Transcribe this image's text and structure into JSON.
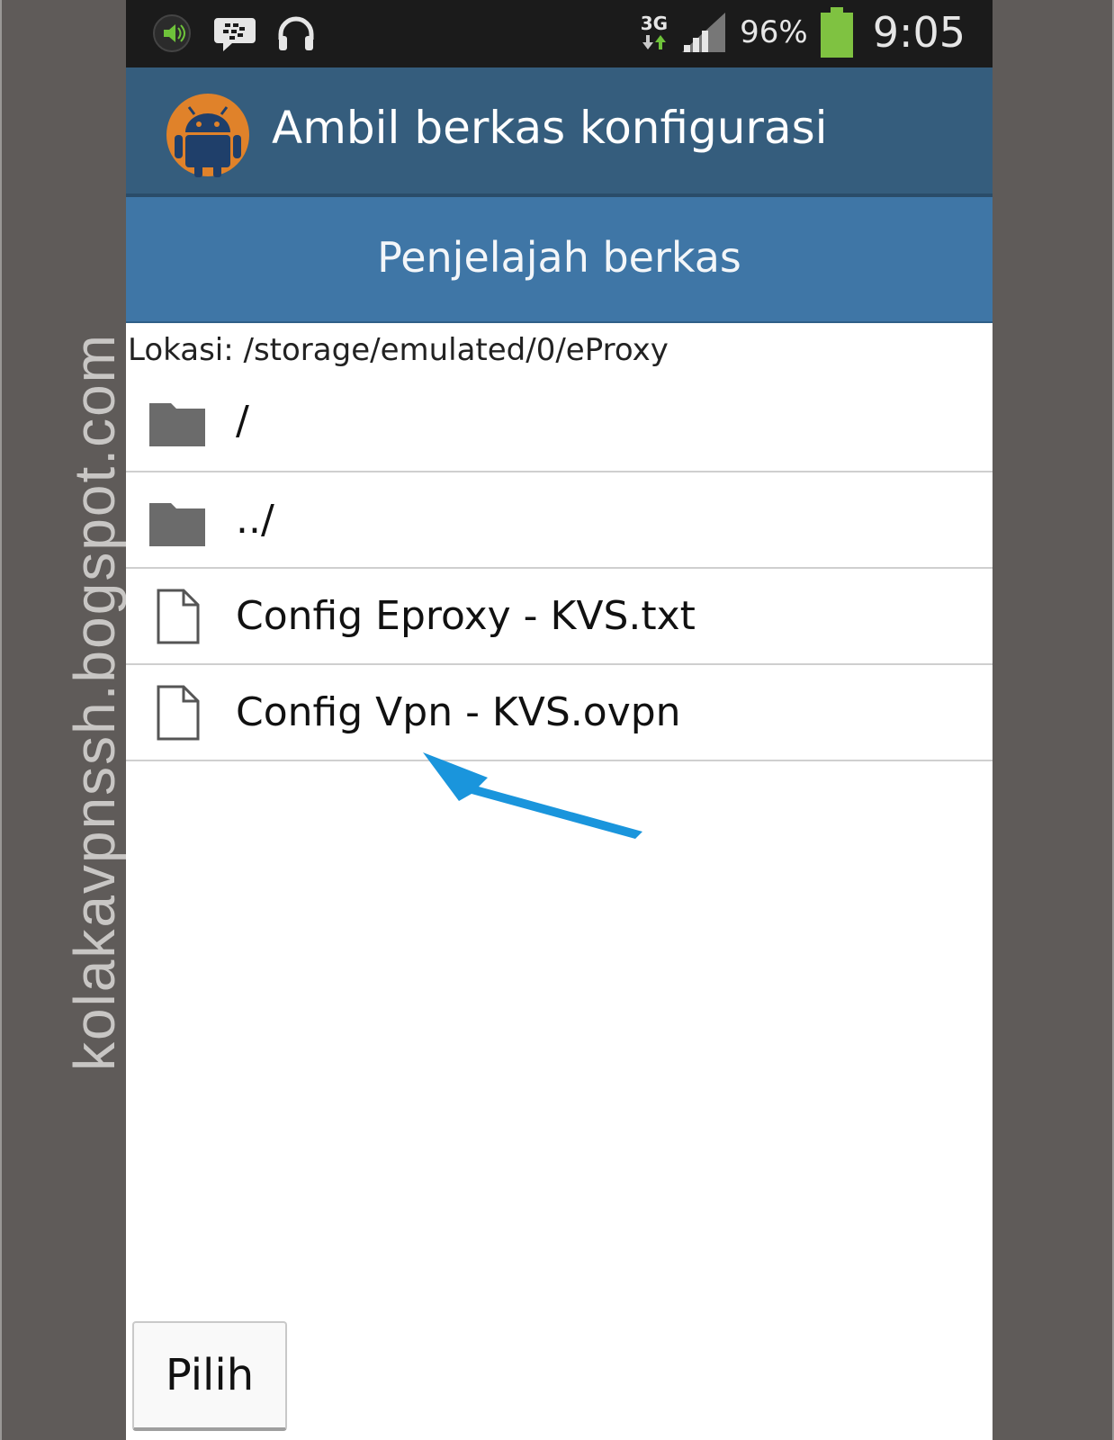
{
  "watermark": "kolakavpnssh.bogspot.com",
  "statusbar": {
    "network": "3G",
    "battery_percent": "96%",
    "time": "9:05",
    "icons": [
      "volume-icon",
      "bbm-icon",
      "headset-icon",
      "data-arrows-icon",
      "signal-icon",
      "battery-icon"
    ]
  },
  "actionbar": {
    "title": "Ambil berkas konfigurasi",
    "icon": "android-app-icon"
  },
  "tab": {
    "label": "Penjelajah berkas"
  },
  "location": {
    "text": "Lokasi: /storage/emulated/0/eProxy"
  },
  "files": [
    {
      "label": "/",
      "icon": "folder-icon"
    },
    {
      "label": "../",
      "icon": "folder-icon"
    },
    {
      "label": "Config Eproxy - KVS.txt",
      "icon": "file-icon"
    },
    {
      "label": "Config Vpn - KVS.ovpn",
      "icon": "file-icon"
    }
  ],
  "footer": {
    "pick_label": "Pilih"
  },
  "colors": {
    "actionbar": "#355d7d",
    "tabbar": "#3f76a6",
    "statusbar": "#1b1b1b",
    "arrow": "#1a95dc",
    "battery": "#7fc241"
  }
}
